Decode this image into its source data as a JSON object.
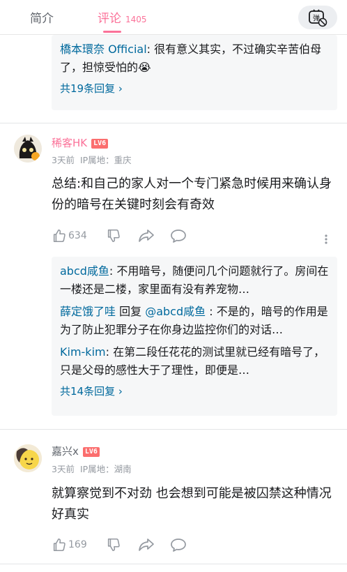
{
  "tabs": {
    "intro_label": "简介",
    "comments_label": "评论",
    "comments_count": "1405"
  },
  "danmaku": {
    "icon": "danmaku-off-icon",
    "glyph": "弹"
  },
  "top_reply_box": {
    "reply_user": "橋本環奈 Official",
    "reply_text": ": 很有意义其实，不过确实辛苦伯母了，担惊受怕的",
    "reply_emoji": "😭",
    "more_label": "共19条回复"
  },
  "comment1": {
    "username": "稀客HK",
    "level": "LV6",
    "time": "3天前",
    "ip": "IP属地：重庆",
    "content": "总结:和自己的家人对一个专门紧急时候用来确认身份的暗号在关键时刻会有奇效",
    "likes": "634",
    "replies": [
      {
        "user": "abcd咸鱼",
        "text": ": 不用暗号，随便问几个问题就行了。房间在一楼还是二楼，家里面有没有养宠物…"
      },
      {
        "user": "薛定饿了哇",
        "reply_word": " 回复 ",
        "mention": "@abcd咸鱼",
        "text": " : 不是的，暗号的作用是为了防止犯罪分子在你身边监控你们的对话…"
      },
      {
        "user": "Kim-kim",
        "text": ": 在第二段任花花的测试里就已经有暗号了，只是父母的感性大于了理性，即便是…"
      }
    ],
    "more_label": "共14条回复"
  },
  "comment2": {
    "username": "嘉兴x",
    "level": "LV6",
    "time": "3天前",
    "ip": "IP属地：湖南",
    "content": "就算察觉到不对劲 也会想到可能是被囚禁这种情况 好真实",
    "likes": "169"
  },
  "colors": {
    "accent": "#fb7299",
    "link": "#00699d",
    "level_badge": "#fb6e6e",
    "muted": "#9499a0"
  }
}
